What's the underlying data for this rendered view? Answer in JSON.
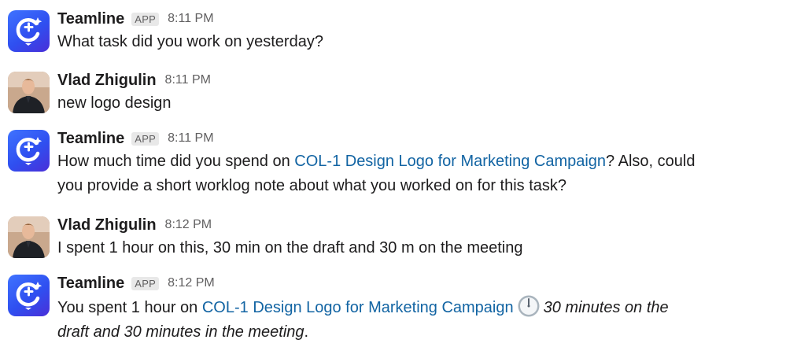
{
  "messages": [
    {
      "sender": "Teamline",
      "badge": "APP",
      "time": "8:11 PM",
      "text": "What task did you work on yesterday?"
    },
    {
      "sender": "Vlad Zhigulin",
      "time": "8:11 PM",
      "text": "new logo design"
    },
    {
      "sender": "Teamline",
      "badge": "APP",
      "time": "8:11 PM",
      "text_before": "How much time did you spend on ",
      "link": "COL-1 Design Logo for Marketing Campaign",
      "text_after_line1": "? Also, could",
      "text_line2": "you provide a short worklog note about what you worked on for this task?"
    },
    {
      "sender": "Vlad Zhigulin",
      "time": "8:12 PM",
      "text": "I spent 1 hour on this, 30 min on the draft and 30 m on the meeting"
    },
    {
      "sender": "Teamline",
      "badge": "APP",
      "time": "8:12 PM",
      "text_before": "You spent 1 hour on ",
      "link": "COL-1 Design Logo for Marketing Campaign",
      "icon": "clock-emoji-icon",
      "italic_line1": "30 minutes on the",
      "italic_line2": "draft and 30 minutes in the meeting",
      "text_end": "."
    }
  ],
  "colors": {
    "link": "#1264a3",
    "app_avatar": "#3a5bf5",
    "badge_bg": "#e8e8e8",
    "muted": "#616061"
  }
}
